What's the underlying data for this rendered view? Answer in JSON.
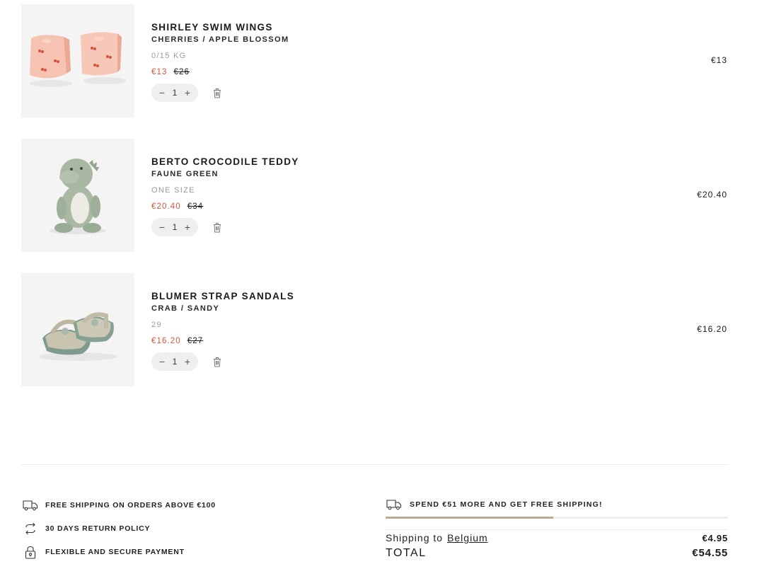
{
  "cart": {
    "items": [
      {
        "name": "SHIRLEY SWIM WINGS",
        "variant": "CHERRIES / APPLE BLOSSOM",
        "size": "0/15 KG",
        "sale_price": "€13",
        "original_price": "€26",
        "quantity": "1",
        "line_total": "€13",
        "image_icon": "swim-wings-image"
      },
      {
        "name": "BERTO CROCODILE TEDDY",
        "variant": "FAUNE GREEN",
        "size": "ONE SIZE",
        "sale_price": "€20.40",
        "original_price": "€34",
        "quantity": "1",
        "line_total": "€20.40",
        "image_icon": "crocodile-teddy-image"
      },
      {
        "name": "BLUMER STRAP SANDALS",
        "variant": "CRAB / SANDY",
        "size": "29",
        "sale_price": "€16.20",
        "original_price": "€27",
        "quantity": "1",
        "line_total": "€16.20",
        "image_icon": "sandals-image"
      }
    ],
    "controls": {
      "minus": "−",
      "plus": "+"
    }
  },
  "usps": [
    {
      "text": "FREE SHIPPING ON ORDERS ABOVE €100",
      "icon": "truck-icon"
    },
    {
      "text": "30 DAYS RETURN POLICY",
      "icon": "return-arrows-icon"
    },
    {
      "text": "FLEXIBLE AND SECURE PAYMENT",
      "icon": "padlock-icon"
    }
  ],
  "free_shipping": {
    "message": "SPEND €51 MORE AND GET FREE SHIPPING!",
    "progress_fraction": 0.49,
    "icon": "truck-icon"
  },
  "summary": {
    "shipping_label": "Shipping to",
    "shipping_country": "Belgium",
    "shipping_cost": "€4.95",
    "total_label": "TOTAL",
    "total_value": "€54.55"
  },
  "colors": {
    "sale_price": "#d9533e",
    "progress_fill": "#b9ab8e",
    "quantity_pill": "#efefed",
    "thumbnail_bg": "#f4f4f4"
  }
}
